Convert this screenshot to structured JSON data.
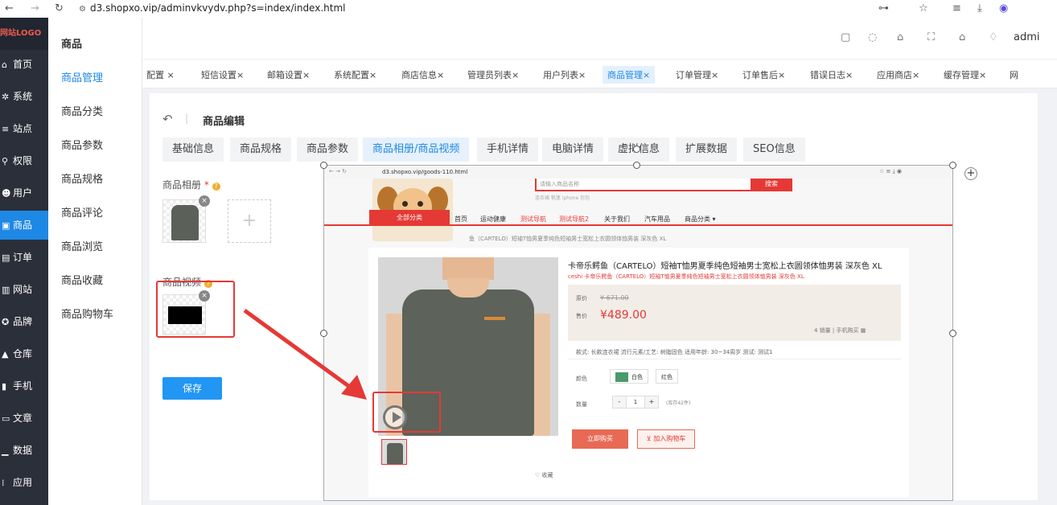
{
  "browser": {
    "url": "d3.shopxo.vip/adminvkvydv.php?s=index/index.html"
  },
  "sidebar": {
    "logo": "网站LOGO",
    "items": [
      {
        "icon": "home-icon",
        "glyph": "⌂",
        "label": "首页"
      },
      {
        "icon": "gear-icon",
        "glyph": "✲",
        "label": "系统"
      },
      {
        "icon": "sliders-icon",
        "glyph": "≡",
        "label": "站点"
      },
      {
        "icon": "user-key-icon",
        "glyph": "⚲",
        "label": "权限"
      },
      {
        "icon": "user-icon",
        "glyph": "☻",
        "label": "用户"
      },
      {
        "icon": "shop-icon",
        "glyph": "▣",
        "label": "商品"
      },
      {
        "icon": "order-icon",
        "glyph": "▤",
        "label": "订单"
      },
      {
        "icon": "monitor-icon",
        "glyph": "▥",
        "label": "网站"
      },
      {
        "icon": "brand-icon",
        "glyph": "✪",
        "label": "品牌"
      },
      {
        "icon": "warehouse-icon",
        "glyph": "▲",
        "label": "仓库"
      },
      {
        "icon": "mobile-icon",
        "glyph": "▮",
        "label": "手机"
      },
      {
        "icon": "article-icon",
        "glyph": "▭",
        "label": "文章"
      },
      {
        "icon": "chart-icon",
        "glyph": "▁",
        "label": "数据"
      },
      {
        "icon": "apps-icon",
        "glyph": "⁞",
        "label": "应用"
      }
    ],
    "active_index": 5
  },
  "submenu": {
    "title": "商品",
    "items": [
      "商品管理",
      "商品分类",
      "商品参数",
      "商品规格",
      "商品评论",
      "商品浏览",
      "商品收藏",
      "商品购物车"
    ]
  },
  "header": {
    "user": "admi"
  },
  "tabs": [
    "配置 ×",
    "短信设置×",
    "邮箱设置×",
    "系统配置×",
    "商店信息×",
    "管理员列表×",
    "用户列表×",
    "商品管理×",
    "订单管理×",
    "订单售后×",
    "错误日志×",
    "应用商店×",
    "缓存管理×",
    "网"
  ],
  "active_tab": 7,
  "editor": {
    "title": "商品编辑",
    "tabs": [
      "基础信息",
      "商品规格",
      "商品参数",
      "商品相册/商品视频",
      "手机详情",
      "电脑详情",
      "虚拟信息",
      "扩展数据",
      "SEO信息"
    ],
    "active_tab": 3,
    "album_label": "商品相册",
    "video_label": "商品视频",
    "required_mark": "*",
    "help_mark": "?",
    "add_mark": "+",
    "remove_mark": "×",
    "save_label": "保存"
  },
  "preview": {
    "url": "d3.shopxo.vip/goods-110.html",
    "search_placeholder": "请输入商品名称",
    "search_button": "搜索",
    "hot_words": "连衣裙  帆蓬  iphone  包包",
    "all_categories": "全部分类",
    "nav": [
      "首页",
      "运动健康",
      "测试导航",
      "测试导航2",
      "关于我们",
      "汽车用品",
      "商品分类 ▾"
    ],
    "nav_red": [
      2,
      3
    ],
    "breadcrumb": "鱼（CARTELO）短袖T恤男夏季纯色短袖男士宽松上衣圆领体恤男装 深灰色 XL",
    "title": "卡帝乐鳄鱼（CARTELO）短袖T恤男夏季纯色短袖男士宽松上衣圆领体恤男装 深灰色 XL",
    "subtitle": "ceshi 卡帝乐鳄鱼（CARTELO）短袖T恤男夏季纯色短袖男士宽松上衣圆领体恤男装 深灰色 XL",
    "orig_label": "原价",
    "orig_price": "¥ 671.00",
    "sale_label": "售价",
    "sale_price": "¥489.00",
    "sold": "4 销量  |  手机购买 ▦",
    "attrs": "款式: 长款连衣裙    流行元素/工艺: 树脂固色    适用年龄: 30~34周岁    测试: 测试1",
    "color_label": "颜色",
    "colors": [
      "白色",
      "红色"
    ],
    "qty_label": "数量",
    "qty_minus": "-",
    "qty_value": "1",
    "qty_plus": "+",
    "stock": "(库存42件)",
    "buy": "立即购买",
    "cart": "加入购物车",
    "fav": "♡ 收藏"
  },
  "colors": {
    "accent": "#1e88e5",
    "sidebar_bg": "#2b2f3a",
    "annotation": "#e53935"
  }
}
